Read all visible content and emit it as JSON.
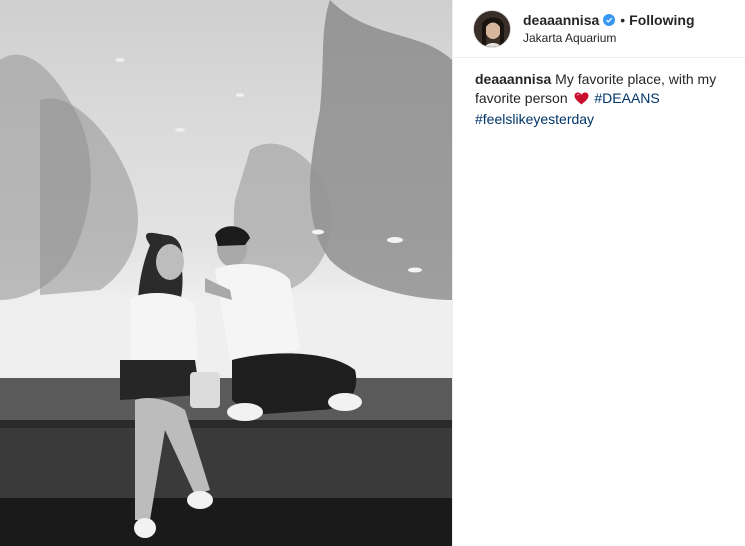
{
  "post": {
    "username": "deaaannisa",
    "verified": true,
    "separator": "•",
    "follow_status": "Following",
    "location": "Jakarta Aquarium"
  },
  "caption": {
    "username": "deaaannisa",
    "text": " My favorite place, with my favorite person ",
    "emoji": "heart-icon",
    "hashtag_1": "#DEAANS",
    "hashtag_2": "#feelslikeyesterday"
  },
  "colors": {
    "verified_badge": "#3897f0",
    "hashtag": "#003569",
    "heart": "#c8102e"
  }
}
